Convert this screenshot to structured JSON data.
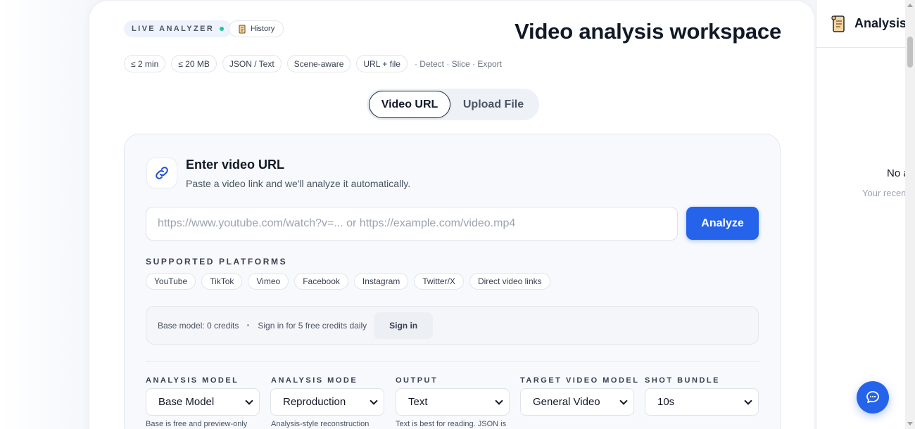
{
  "header": {
    "live_badge": "LIVE ANALYZER",
    "history_label": "History",
    "title": "Video analysis workspace",
    "chips": [
      "≤ 2 min",
      "≤ 20 MB",
      "JSON / Text",
      "Scene-aware",
      "URL + file"
    ],
    "chip_note": "· Detect · Slice · Export"
  },
  "tabs": {
    "video_url": "Video URL",
    "upload_file": "Upload File"
  },
  "form": {
    "title": "Enter video URL",
    "subtitle": "Paste a video link and we'll analyze it automatically.",
    "url_placeholder": "https://www.youtube.com/watch?v=... or https://example.com/video.mp4",
    "analyze_label": "Analyze",
    "platforms_label": "SUPPORTED PLATFORMS",
    "platforms": [
      "YouTube",
      "TikTok",
      "Vimeo",
      "Facebook",
      "Instagram",
      "Twitter/X",
      "Direct video links"
    ],
    "credits": {
      "base_model": "Base model: 0 credits",
      "signin_note": "Sign in for 5 free credits daily",
      "signin_label": "Sign in"
    },
    "fields": [
      {
        "label": "ANALYSIS MODEL",
        "value": "Base Model",
        "help": "Base is free and preview-only"
      },
      {
        "label": "ANALYSIS MODE",
        "value": "Reproduction",
        "help": "Analysis-style reconstruction"
      },
      {
        "label": "OUTPUT",
        "value": "Text",
        "help": "Text is best for reading. JSON is"
      },
      {
        "label": "TARGET VIDEO MODEL",
        "value": "General Video",
        "help": ""
      },
      {
        "label": "SHOT BUNDLE",
        "value": "10s",
        "help": ""
      }
    ]
  },
  "side_panel": {
    "title": "Analysis",
    "empty_title": "No a",
    "empty_sub": "Your recen"
  },
  "colors": {
    "accent": "#2563eb",
    "live_dot": "#22c59a"
  },
  "icons": [
    "scroll-icon",
    "link-icon",
    "chat-icon",
    "chevron-down-icon"
  ]
}
